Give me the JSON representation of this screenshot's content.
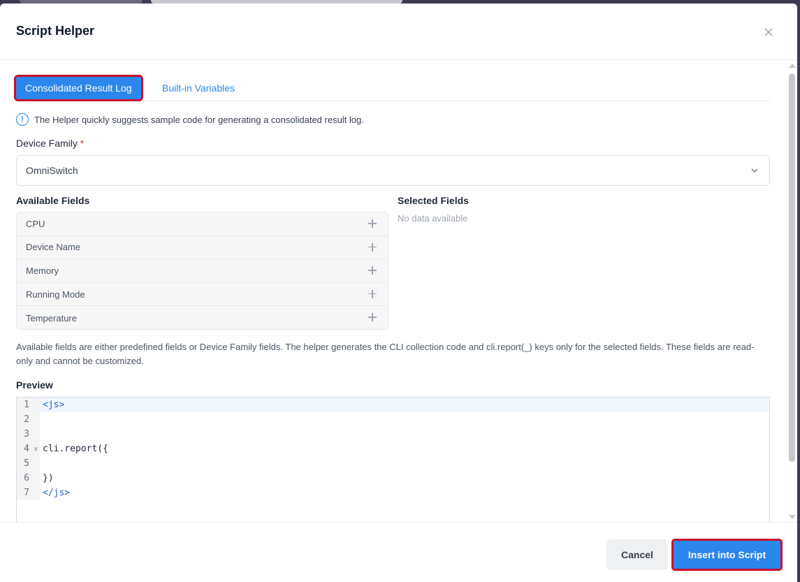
{
  "modal": {
    "title": "Script Helper"
  },
  "tabs": [
    {
      "label": "Consolidated Result Log",
      "active": true
    },
    {
      "label": "Built-in Variables",
      "active": false
    }
  ],
  "info": {
    "icon": "info-circle-icon",
    "text": "The Helper quickly suggests sample code for generating a consolidated result log."
  },
  "device_family": {
    "label": "Device Family",
    "required_mark": "*",
    "value": "OmniSwitch"
  },
  "available_fields": {
    "title": "Available Fields",
    "items": [
      "CPU",
      "Device Name",
      "Memory",
      "Running Mode",
      "Temperature"
    ]
  },
  "selected_fields": {
    "title": "Selected Fields",
    "empty_text": "No data available"
  },
  "help_text": "Available fields are either predefined fields or Device Family fields. The helper generates the CLI collection code and cli.report(_) keys only for the selected fields. These fields are read-only and cannot be customized.",
  "preview": {
    "title": "Preview",
    "lines": [
      {
        "num": "1",
        "text": "<js>"
      },
      {
        "num": "2",
        "text": ""
      },
      {
        "num": "3",
        "text": ""
      },
      {
        "num": "4",
        "text": "cli.report({"
      },
      {
        "num": "5",
        "text": ""
      },
      {
        "num": "6",
        "text": "})"
      },
      {
        "num": "7",
        "text": "</js>"
      }
    ]
  },
  "footer": {
    "cancel_label": "Cancel",
    "insert_label": "Insert into Script"
  },
  "colors": {
    "accent": "#2b87ec",
    "highlight_outline": "#c8102e"
  }
}
